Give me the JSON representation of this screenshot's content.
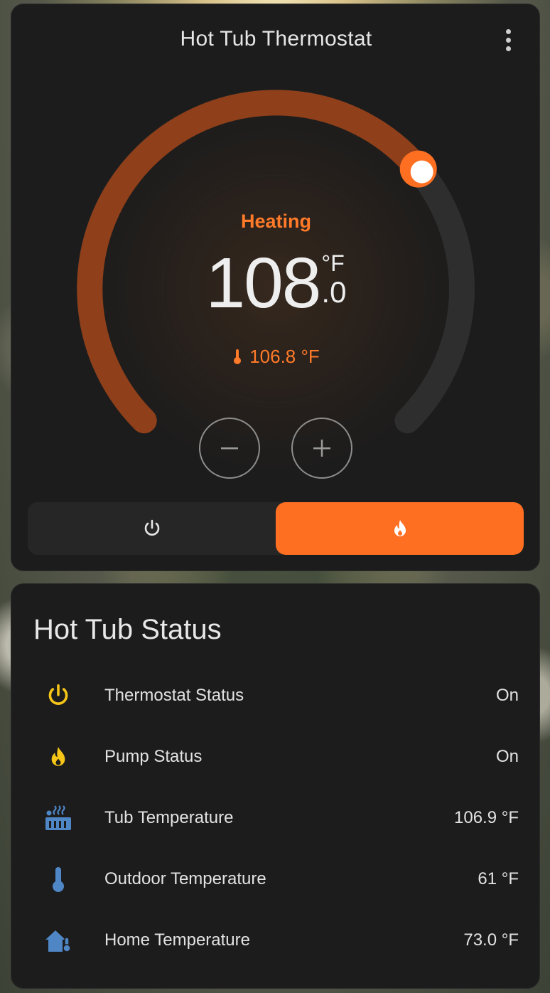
{
  "thermostat": {
    "title": "Hot Tub Thermostat",
    "hvac_action": "Heating",
    "target_integer": "108",
    "target_unit": "°F",
    "target_decimal": ".0",
    "current_temperature": "106.8 °F",
    "accent_color": "#ff6f22",
    "modes": [
      {
        "name": "off",
        "icon": "power-icon",
        "active": false
      },
      {
        "name": "heat",
        "icon": "flame-icon",
        "active": true
      }
    ]
  },
  "status": {
    "title": "Hot Tub Status",
    "rows": [
      {
        "label": "Thermostat Status",
        "value": "On",
        "icon": "power-icon",
        "icon_color": "#f5c518"
      },
      {
        "label": "Pump Status",
        "value": "On",
        "icon": "flame-icon",
        "icon_color": "#f5c518"
      },
      {
        "label": "Tub Temperature",
        "value": "106.9 °F",
        "icon": "hot-tub-icon",
        "icon_color": "#4f86c6"
      },
      {
        "label": "Outdoor Temperature",
        "value": "61 °F",
        "icon": "thermometer-icon",
        "icon_color": "#4f86c6"
      },
      {
        "label": "Home Temperature",
        "value": "73.0 °F",
        "icon": "home-thermometer-icon",
        "icon_color": "#4f86c6"
      }
    ]
  }
}
